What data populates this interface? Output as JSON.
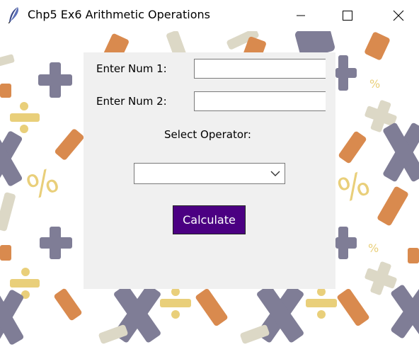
{
  "window": {
    "title": "Chp5 Ex6 Arithmetic Operations",
    "icon": "feather-icon",
    "controls": [
      "minimize-icon",
      "maximize-icon",
      "close-icon"
    ]
  },
  "form": {
    "num1_label": "Enter Num 1:",
    "num1_value": "",
    "num2_label": "Enter Num 2:",
    "num2_value": "",
    "operator_label": "Select Operator:",
    "operator_selected": "",
    "calculate_label": "Calculate"
  },
  "colors": {
    "button_bg": "#4b0082",
    "button_text": "#ffffff",
    "panel_bg": "#f0f0f0",
    "pattern_orange": "#d98a4e",
    "pattern_yellow": "#e9cf7a",
    "pattern_slate": "#7f7d96",
    "pattern_beige": "#dcd8c6"
  }
}
